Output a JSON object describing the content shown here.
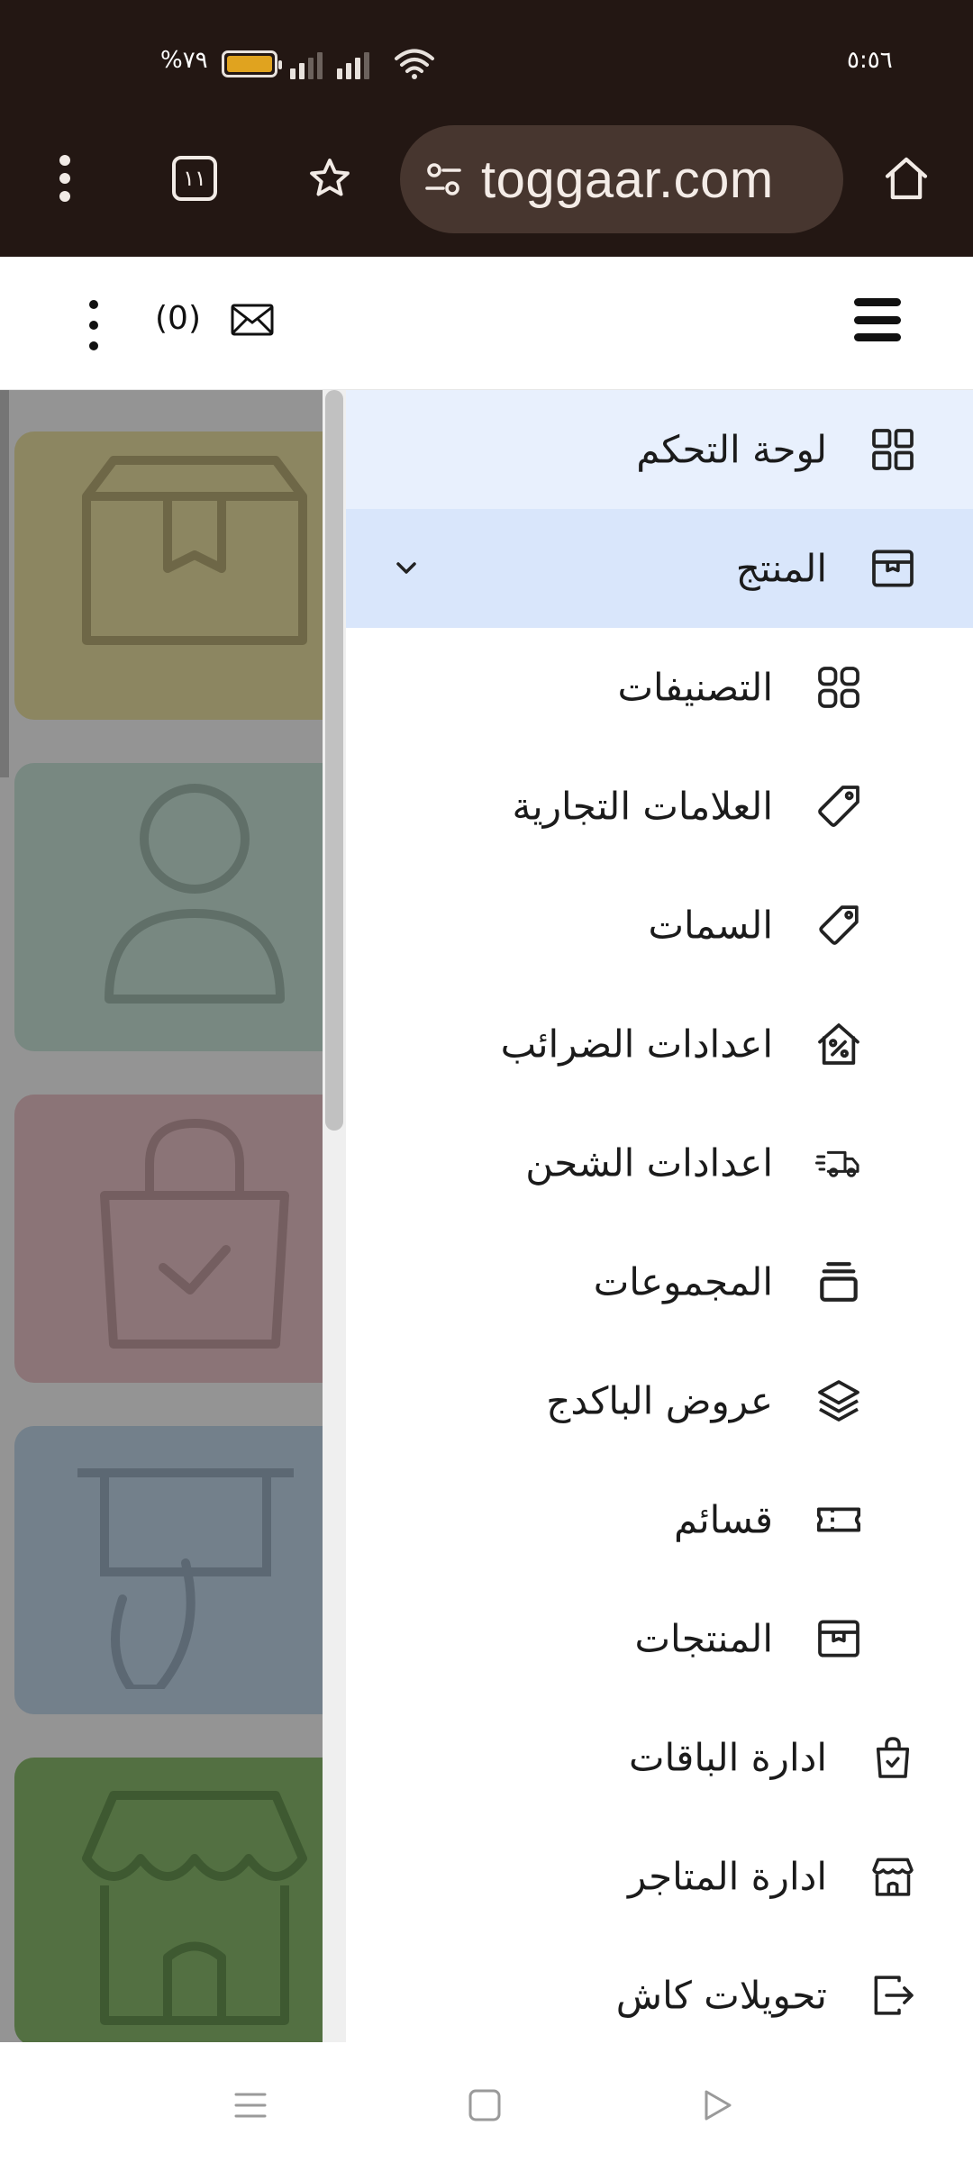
{
  "status_bar": {
    "time": "٥:٥٦",
    "battery_pct": "%٧٩"
  },
  "browser": {
    "tab_count": "١١",
    "url": "toggaar.com"
  },
  "header": {
    "message_count": "(0)"
  },
  "drawer": {
    "items": [
      {
        "label": "لوحة التحكم",
        "icon": "dashboard-grid-icon"
      },
      {
        "label": "المنتج",
        "icon": "archive-box-icon"
      },
      {
        "label": "التصنيفات",
        "icon": "categories-grid-icon"
      },
      {
        "label": "العلامات التجارية",
        "icon": "tag-icon"
      },
      {
        "label": "السمات",
        "icon": "tag-icon"
      },
      {
        "label": "اعدادات الضرائب",
        "icon": "tax-percent-house-icon"
      },
      {
        "label": "اعدادات الشحن",
        "icon": "truck-fast-icon"
      },
      {
        "label": "المجموعات",
        "icon": "stack-icon"
      },
      {
        "label": "عروض الباكدج",
        "icon": "layers-icon"
      },
      {
        "label": "قسائم",
        "icon": "ticket-icon"
      },
      {
        "label": "المنتجات",
        "icon": "archive-box-icon"
      },
      {
        "label": "ادارة الباقات",
        "icon": "shopping-bag-check-icon"
      },
      {
        "label": "ادارة المتاجر",
        "icon": "storefront-icon"
      },
      {
        "label": "تحويلات كاش",
        "icon": "transfer-out-icon"
      }
    ]
  },
  "colors": {
    "chrome_bg": "#231713",
    "omnibox_bg": "#47362f",
    "drawer_active": "#e8f0fd",
    "drawer_open": "#d9e6fb",
    "card_1": "#f1e7a8",
    "card_2": "#cfeadf",
    "card_3": "#f0c9cd",
    "card_4": "#c6dcef",
    "card_5": "#8fc273"
  }
}
